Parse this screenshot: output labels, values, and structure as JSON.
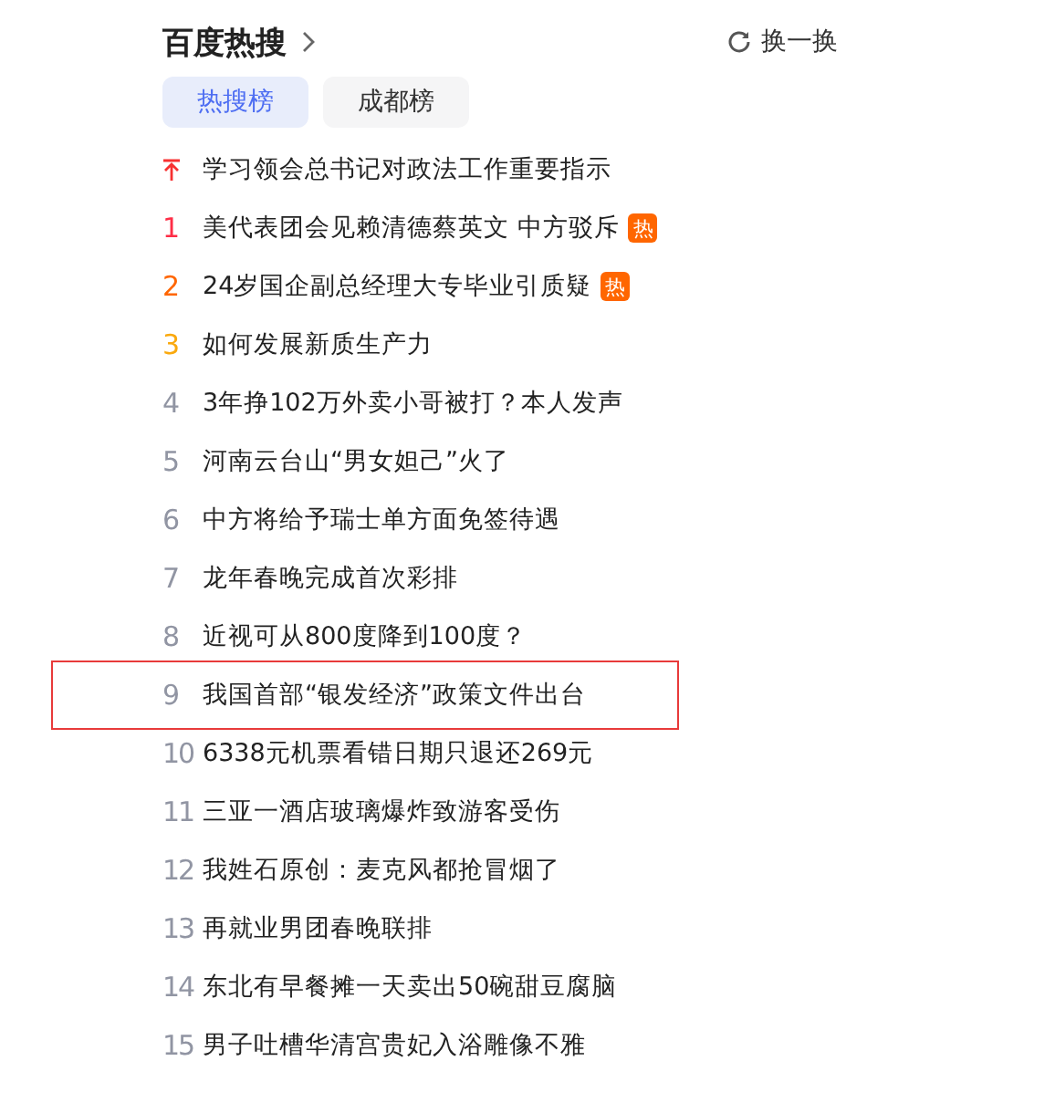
{
  "header": {
    "title": "百度热搜",
    "refresh_label": "换一换"
  },
  "tabs": [
    {
      "label": "热搜榜",
      "selected": true
    },
    {
      "label": "成都榜",
      "selected": false
    }
  ],
  "items": [
    {
      "kind": "pinned",
      "title": "学习领会总书记对政法工作重要指示",
      "hot": false,
      "highlighted": false
    },
    {
      "kind": "ranked",
      "rank": "1",
      "title": "美代表团会见赖清德蔡英文 中方驳斥",
      "hot": true,
      "badge": "热",
      "highlighted": false
    },
    {
      "kind": "ranked",
      "rank": "2",
      "title": "24岁国企副总经理大专毕业引质疑",
      "hot": true,
      "badge": "热",
      "highlighted": false
    },
    {
      "kind": "ranked",
      "rank": "3",
      "title": "如何发展新质生产力",
      "hot": false,
      "highlighted": false
    },
    {
      "kind": "ranked",
      "rank": "4",
      "title": "3年挣102万外卖小哥被打？本人发声",
      "hot": false,
      "highlighted": false
    },
    {
      "kind": "ranked",
      "rank": "5",
      "title": "河南云台山“男女妲己”火了",
      "hot": false,
      "highlighted": false
    },
    {
      "kind": "ranked",
      "rank": "6",
      "title": "中方将给予瑞士单方面免签待遇",
      "hot": false,
      "highlighted": false
    },
    {
      "kind": "ranked",
      "rank": "7",
      "title": "龙年春晚完成首次彩排",
      "hot": false,
      "highlighted": false
    },
    {
      "kind": "ranked",
      "rank": "8",
      "title": "近视可从800度降到100度？",
      "hot": false,
      "highlighted": false
    },
    {
      "kind": "ranked",
      "rank": "9",
      "title": "我国首部“银发经济”政策文件出台",
      "hot": false,
      "highlighted": true
    },
    {
      "kind": "ranked",
      "rank": "10",
      "title": "6338元机票看错日期只退还269元",
      "hot": false,
      "highlighted": false
    },
    {
      "kind": "ranked",
      "rank": "11",
      "title": "三亚一酒店玻璃爆炸致游客受伤",
      "hot": false,
      "highlighted": false
    },
    {
      "kind": "ranked",
      "rank": "12",
      "title": "我姓石原创：麦克风都抢冒烟了",
      "hot": false,
      "highlighted": false
    },
    {
      "kind": "ranked",
      "rank": "13",
      "title": "再就业男团春晚联排",
      "hot": false,
      "highlighted": false
    },
    {
      "kind": "ranked",
      "rank": "14",
      "title": "东北有早餐摊一天卖出50碗甜豆腐脑",
      "hot": false,
      "highlighted": false
    },
    {
      "kind": "ranked",
      "rank": "15",
      "title": "男子吐槽华清宫贵妃入浴雕像不雅",
      "hot": false,
      "highlighted": false
    }
  ]
}
